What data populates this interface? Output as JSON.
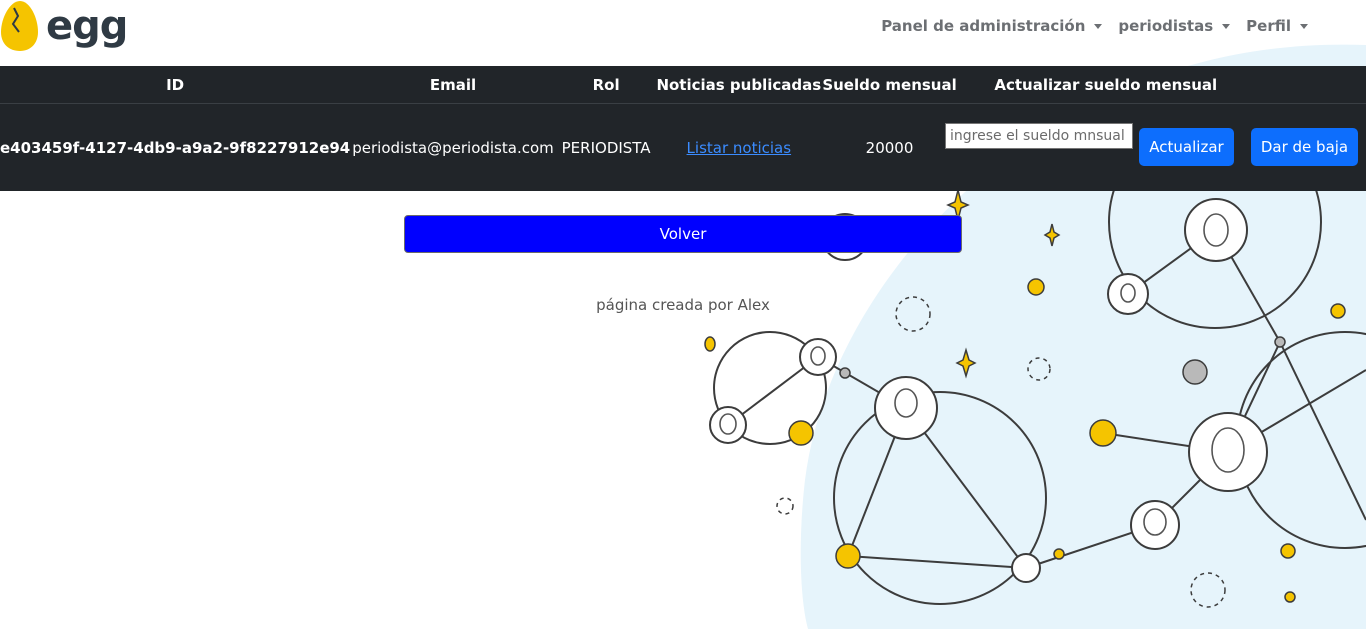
{
  "brand": {
    "logo_text": "egg",
    "accent": "#0d6efd",
    "egg_color": "#f5c400"
  },
  "nav": {
    "items": [
      {
        "label": "Panel de administración"
      },
      {
        "label": "periodistas"
      },
      {
        "label": "Perfil"
      }
    ]
  },
  "table": {
    "headers": [
      "ID",
      "Email",
      "Rol",
      "Noticias publicadas",
      "Sueldo mensual",
      "Actualizar sueldo mensual"
    ],
    "row": {
      "id": "e403459f-4127-4db9-a9a2-9f8227912e94",
      "email": "periodista@periodista.com",
      "role": "PERIODISTA",
      "news_link": "Listar noticias",
      "salary": "20000"
    },
    "salary_input": {
      "placeholder": "ingrese el sueldo mnsual",
      "value": ""
    },
    "update_button": "Actualizar",
    "remove_button": "Dar de baja"
  },
  "back_button": "Volver",
  "footer": "página creada por Alex"
}
